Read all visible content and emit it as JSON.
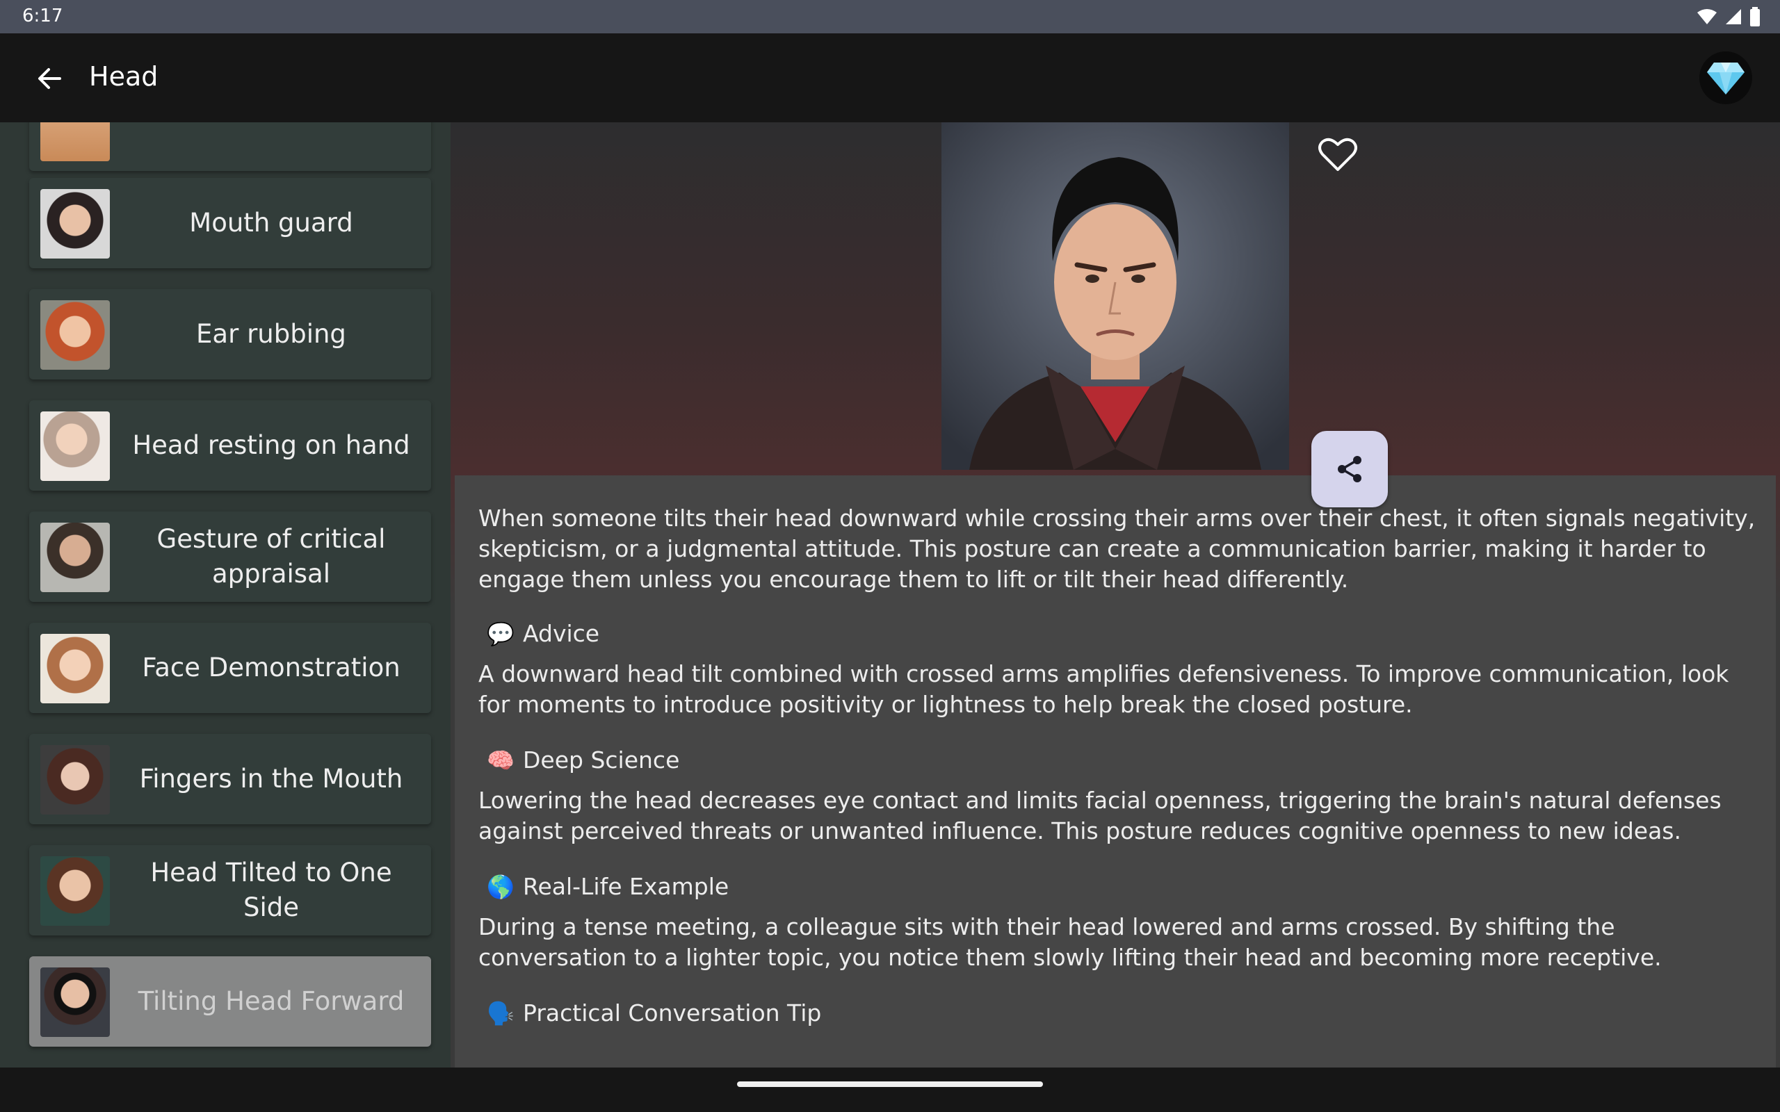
{
  "status": {
    "time": "6:17"
  },
  "appbar": {
    "title": "Head"
  },
  "sidebar": {
    "items": [
      {
        "label": ""
      },
      {
        "label": "Mouth guard"
      },
      {
        "label": "Ear rubbing"
      },
      {
        "label": "Head resting on hand"
      },
      {
        "label": "Gesture of critical appraisal"
      },
      {
        "label": "Face Demonstration"
      },
      {
        "label": "Fingers in the Mouth"
      },
      {
        "label": "Head Tilted to One Side"
      },
      {
        "label": "Tilting Head Forward"
      }
    ],
    "selected_index": 8
  },
  "content": {
    "intro": "When someone tilts their head downward while crossing their arms over their chest, it often signals negativity, skepticism, or a judgmental attitude. This posture can create a communication barrier, making it harder to engage them unless you encourage them to lift or tilt their head differently.",
    "sections": [
      {
        "emoji": "💬",
        "title": "Advice",
        "text": "A downward head tilt combined with crossed arms amplifies defensiveness. To improve communication, look for moments to introduce positivity or lightness to help break the closed posture."
      },
      {
        "emoji": "🧠",
        "title": "Deep Science",
        "text": "Lowering the head decreases eye contact and limits facial openness, triggering the brain's natural defenses against perceived threats or unwanted influence. This posture reduces cognitive openness to new ideas."
      },
      {
        "emoji": "🌎",
        "title": "Real-Life Example",
        "text": "During a tense meeting, a colleague sits with their head lowered and arms crossed. By shifting the conversation to a lighter topic, you notice them slowly lifting their head and becoming more receptive."
      },
      {
        "emoji": "🗣️",
        "title": "Practical Conversation Tip",
        "text": ""
      }
    ]
  },
  "colors": {
    "selected_item": "#868787",
    "share_button": "#d5d4ec",
    "accent_red": "#c0283a"
  },
  "icons": {
    "back": "arrow-left-icon",
    "premium": "diamond-icon",
    "favorite": "heart-outline-icon",
    "share": "share-icon"
  }
}
